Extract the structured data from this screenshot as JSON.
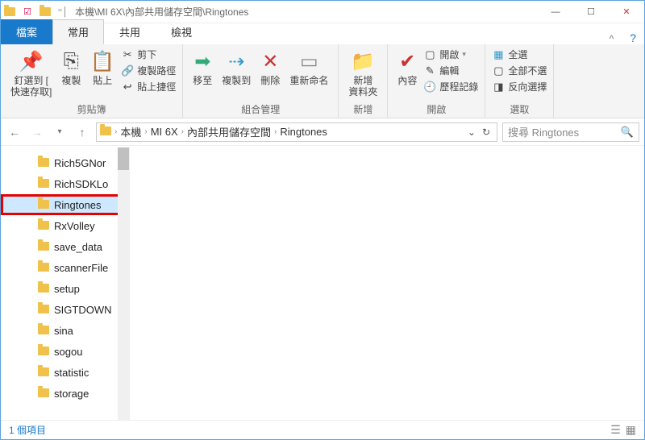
{
  "titlebar": {
    "path": "本機\\MI 6X\\內部共用儲存空間\\Ringtones"
  },
  "tabs": {
    "file": "檔案",
    "home": "常用",
    "share": "共用",
    "view": "檢視"
  },
  "ribbon": {
    "pin": {
      "l1": "釘選到 [",
      "l2": "快速存取]"
    },
    "copy": "複製",
    "paste": "貼上",
    "cut": "剪下",
    "copypath": "複製路徑",
    "pasteshortcut": "貼上捷徑",
    "group_clipboard": "剪貼簿",
    "moveto": "移至",
    "copyto": "複製到",
    "delete": "刪除",
    "rename": "重新命名",
    "group_organize": "組合管理",
    "newfolder": {
      "l1": "新增",
      "l2": "資料夾"
    },
    "group_new": "新增",
    "properties": "內容",
    "open": "開啟",
    "edit": "編輯",
    "history": "歷程記錄",
    "group_open": "開啟",
    "selectall": "全選",
    "selectnone": "全部不選",
    "invert": "反向選擇",
    "group_select": "選取"
  },
  "breadcrumb": [
    "本機",
    "MI 6X",
    "內部共用儲存空間",
    "Ringtones"
  ],
  "search": {
    "placeholder": "搜尋 Ringtones"
  },
  "tree": [
    {
      "name": "Rich5GNor",
      "sel": false,
      "hl": false
    },
    {
      "name": "RichSDKLo",
      "sel": false,
      "hl": false
    },
    {
      "name": "Ringtones",
      "sel": true,
      "hl": true
    },
    {
      "name": "RxVolley",
      "sel": false,
      "hl": false
    },
    {
      "name": "save_data",
      "sel": false,
      "hl": false
    },
    {
      "name": "scannerFile",
      "sel": false,
      "hl": false
    },
    {
      "name": "setup",
      "sel": false,
      "hl": false
    },
    {
      "name": "SIGTDOWN",
      "sel": false,
      "hl": false
    },
    {
      "name": "sina",
      "sel": false,
      "hl": false
    },
    {
      "name": "sogou",
      "sel": false,
      "hl": false
    },
    {
      "name": "statistic",
      "sel": false,
      "hl": false
    },
    {
      "name": "storage",
      "sel": false,
      "hl": false
    }
  ],
  "status": {
    "text": "1 個項目"
  }
}
